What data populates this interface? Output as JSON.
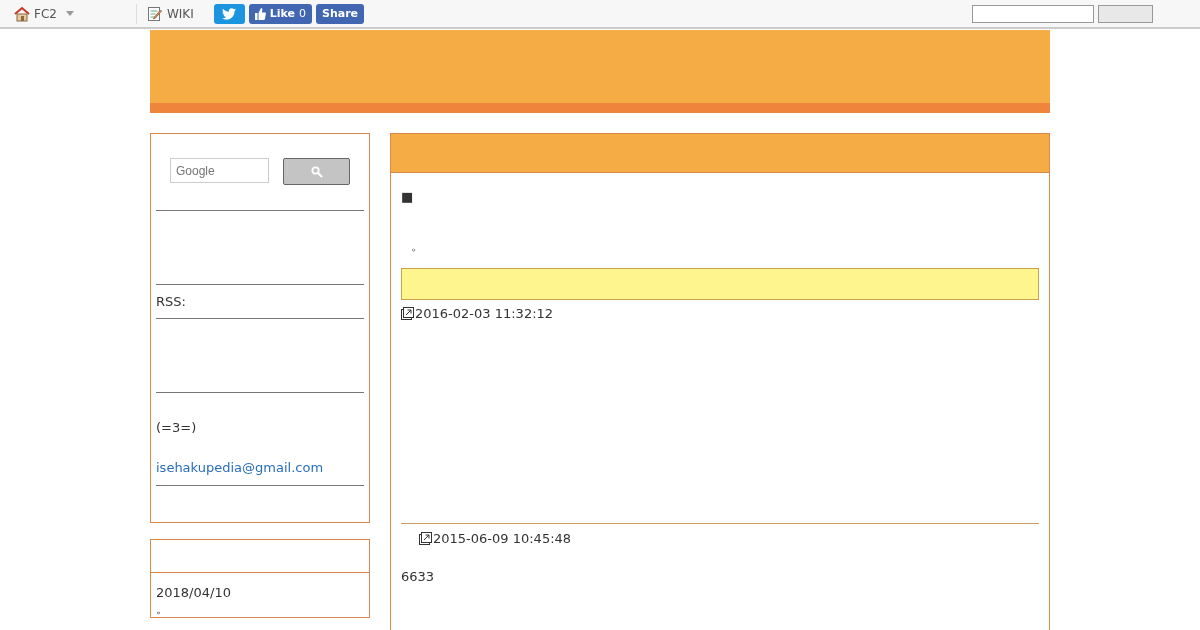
{
  "topbar": {
    "home": "FC2",
    "wiki": "WIKI",
    "like": "Like",
    "like_count": "0",
    "share": "Share"
  },
  "sidebar": {
    "search_placeholder": "Google",
    "rss": "RSS:",
    "note": "(=3=)",
    "email": "isehakupedia@gmail.com",
    "recent": [
      {
        "date": "2018/04/10",
        "text": "。"
      }
    ]
  },
  "main": {
    "marker": "■",
    "line": "。",
    "entries": [
      {
        "date": "2016-02-03 11:32:12",
        "indent": false
      },
      {
        "date": "2015-06-09 10:45:48",
        "indent": true
      }
    ],
    "count": "6633"
  }
}
